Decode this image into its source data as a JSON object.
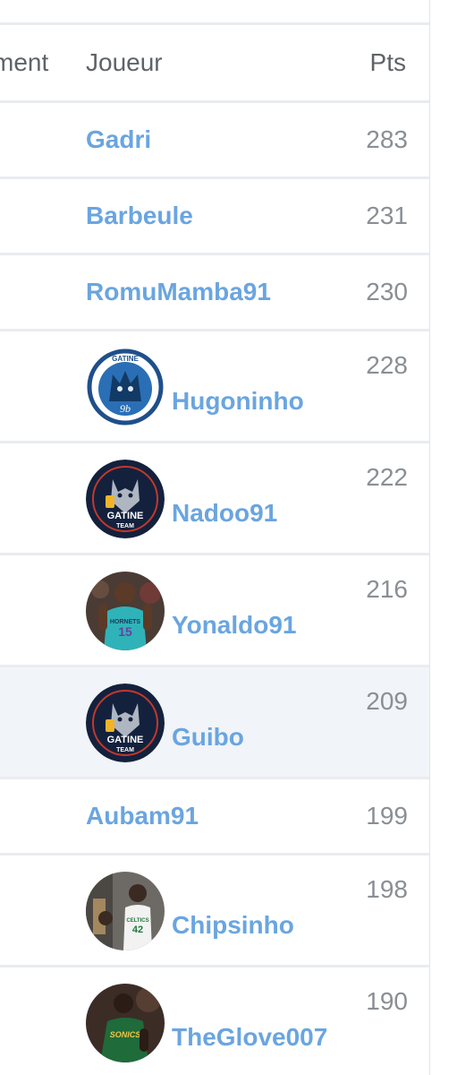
{
  "table": {
    "headers": {
      "rank": "ment",
      "player": "Joueur",
      "points": "Pts"
    },
    "rows": [
      {
        "player": "Gadri",
        "points": "283",
        "avatar": null
      },
      {
        "player": "Barbeule",
        "points": "231",
        "avatar": null
      },
      {
        "player": "RomuMamba91",
        "points": "230",
        "avatar": null
      },
      {
        "player": "Hugoninho",
        "points": "228",
        "avatar": "wolf-logo-white",
        "avatar_text": "GATINE"
      },
      {
        "player": "Nadoo91",
        "points": "222",
        "avatar": "gatine-team-logo",
        "avatar_text": "GATINE TEAM"
      },
      {
        "player": "Yonaldo91",
        "points": "216",
        "avatar": "hornets-player-photo",
        "avatar_text": "HORNETS 15"
      },
      {
        "player": "Guibo",
        "points": "209",
        "avatar": "gatine-team-logo",
        "avatar_text": "GATINE TEAM",
        "highlighted": true
      },
      {
        "player": "Aubam91",
        "points": "199",
        "avatar": null
      },
      {
        "player": "Chipsinho",
        "points": "198",
        "avatar": "celtics-player-photo",
        "avatar_text": "CELTICS 42"
      },
      {
        "player": "TheGlove007",
        "points": "190",
        "avatar": "sonics-player-photo",
        "avatar_text": "SONICS"
      }
    ]
  },
  "colors": {
    "link": "#6aa5e0",
    "points": "#8a8f94",
    "header": "#5f6368",
    "divider": "#e9ecef",
    "highlight_row": "#f1f4f8"
  }
}
